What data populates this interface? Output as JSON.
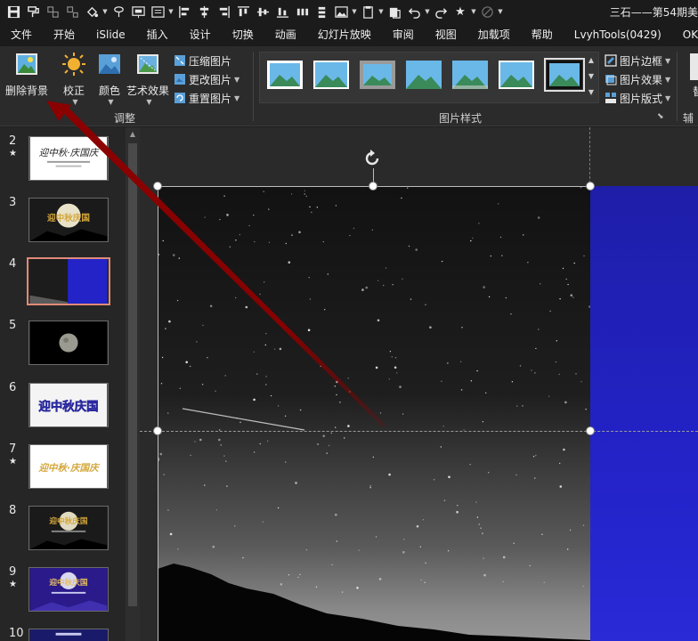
{
  "window": {
    "title": "三石——第54期美"
  },
  "menu": {
    "tabs": [
      "文件",
      "开始",
      "iSlide",
      "插入",
      "设计",
      "切换",
      "动画",
      "幻灯片放映",
      "审阅",
      "视图",
      "加载项",
      "帮助",
      "LvyhTools(0429)",
      "OKPlu"
    ]
  },
  "ribbon": {
    "adjust": {
      "remove_bg": "删除背景",
      "correct": "校正",
      "color": "颜色",
      "art_effects": "艺术效果",
      "compress": "压缩图片",
      "change": "更改图片",
      "reset": "重置图片",
      "group_label": "调整"
    },
    "styles": {
      "group_label": "图片样式",
      "border": "图片边框",
      "effects": "图片效果",
      "layout": "图片版式"
    },
    "partial_group": "辅助",
    "partial_btn": "替"
  },
  "slides": [
    {
      "num": "2",
      "star": "★",
      "kind": "title-white"
    },
    {
      "num": "3",
      "star": "",
      "kind": "moon-title"
    },
    {
      "num": "4",
      "star": "",
      "kind": "stars-blue",
      "active": true
    },
    {
      "num": "5",
      "star": "",
      "kind": "moon-dark"
    },
    {
      "num": "6",
      "star": "",
      "kind": "gold-blue-text"
    },
    {
      "num": "7",
      "star": "★",
      "kind": "gold-text"
    },
    {
      "num": "8",
      "star": "",
      "kind": "moon-title-2"
    },
    {
      "num": "9",
      "star": "★",
      "kind": "purple-moon"
    },
    {
      "num": "10",
      "star": "",
      "kind": "purple"
    }
  ],
  "colors": {
    "arrow": "#8b0000",
    "selection_border": "#e08a78",
    "slide_blue": "#2323c8"
  }
}
